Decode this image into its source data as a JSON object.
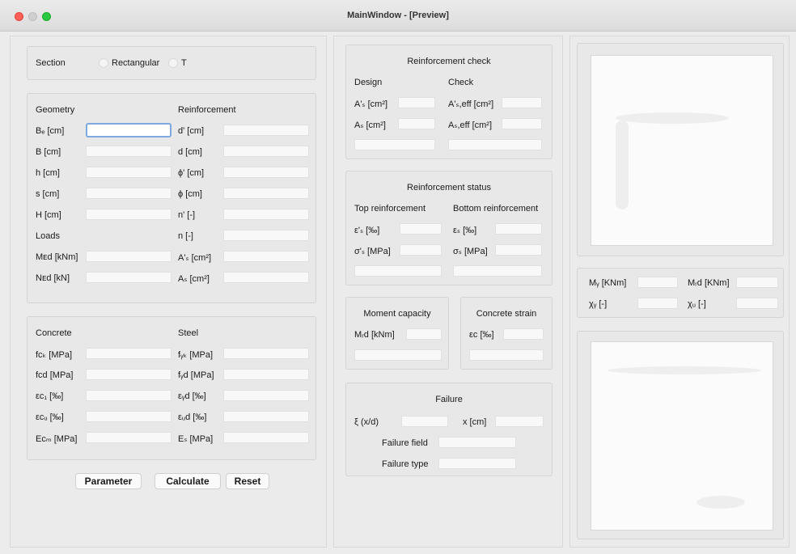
{
  "window": {
    "title": "MainWindow - [Preview]"
  },
  "section": {
    "label": "Section",
    "option_rect": "Rectangular",
    "option_t": "T"
  },
  "geometry": {
    "title": "Geometry",
    "labels": [
      "Bₑ [cm]",
      "B [cm]",
      "h [cm]",
      "s [cm]",
      "H [cm]"
    ]
  },
  "loads": {
    "title": "Loads",
    "labels": [
      "Mᴇd [kNm]",
      "Nᴇd [kN]"
    ]
  },
  "reinforcement": {
    "title": "Reinforcement",
    "labels": [
      "d' [cm]",
      "d [cm]",
      "ϕ' [cm]",
      "ϕ [cm]",
      "n' [-]",
      "n [-]",
      "A'ₛ [cm²]",
      "Aₛ [cm²]"
    ]
  },
  "concrete": {
    "title": "Concrete",
    "labels": [
      "fᴄₖ [MPa]",
      "fᴄd [MPa]",
      "εᴄ₁ [‰]",
      "εᴄᵤ [‰]",
      "Eᴄₘ [MPa]"
    ]
  },
  "steel": {
    "title": "Steel",
    "labels": [
      "fᵧₖ [MPa]",
      "fᵧd [MPa]",
      "εᵧd [‰]",
      "εᵤd [‰]",
      "Eₛ [MPa]"
    ]
  },
  "buttons": {
    "parameter": "Parameter",
    "calculate": "Calculate",
    "reset": "Reset"
  },
  "reinf_check": {
    "title": "Reinforcement check",
    "design": "Design",
    "check": "Check",
    "as_prime": "A'ₛ [cm²]",
    "as": "Aₛ [cm²]",
    "as_prime_eff": "A'ₛ,eff [cm²]",
    "as_eff": "Aₛ,eff [cm²]"
  },
  "reinf_status": {
    "title": "Reinforcement status",
    "top": "Top reinforcement",
    "bottom": "Bottom reinforcement",
    "eps_top": "ε'ₛ [‰]",
    "sig_top": "σ'ₛ [MPa]",
    "eps_bot": "εₛ [‰]",
    "sig_bot": "σₛ [MPa]"
  },
  "moment_capacity": {
    "title": "Moment capacity",
    "label": "Mᵣd [kNm]"
  },
  "concrete_strain": {
    "title": "Concrete strain",
    "label": "εᴄ [‰]"
  },
  "failure": {
    "title": "Failure",
    "xi": "ξ (x/d)",
    "x": "x [cm]",
    "field": "Failure field",
    "type": "Failure type"
  },
  "curvature": {
    "my": "Mᵧ [KNm]",
    "mrd": "Mᵣd [KNm]",
    "chiy": "χᵧ [-]",
    "chiu": "χᵤ [-]"
  }
}
